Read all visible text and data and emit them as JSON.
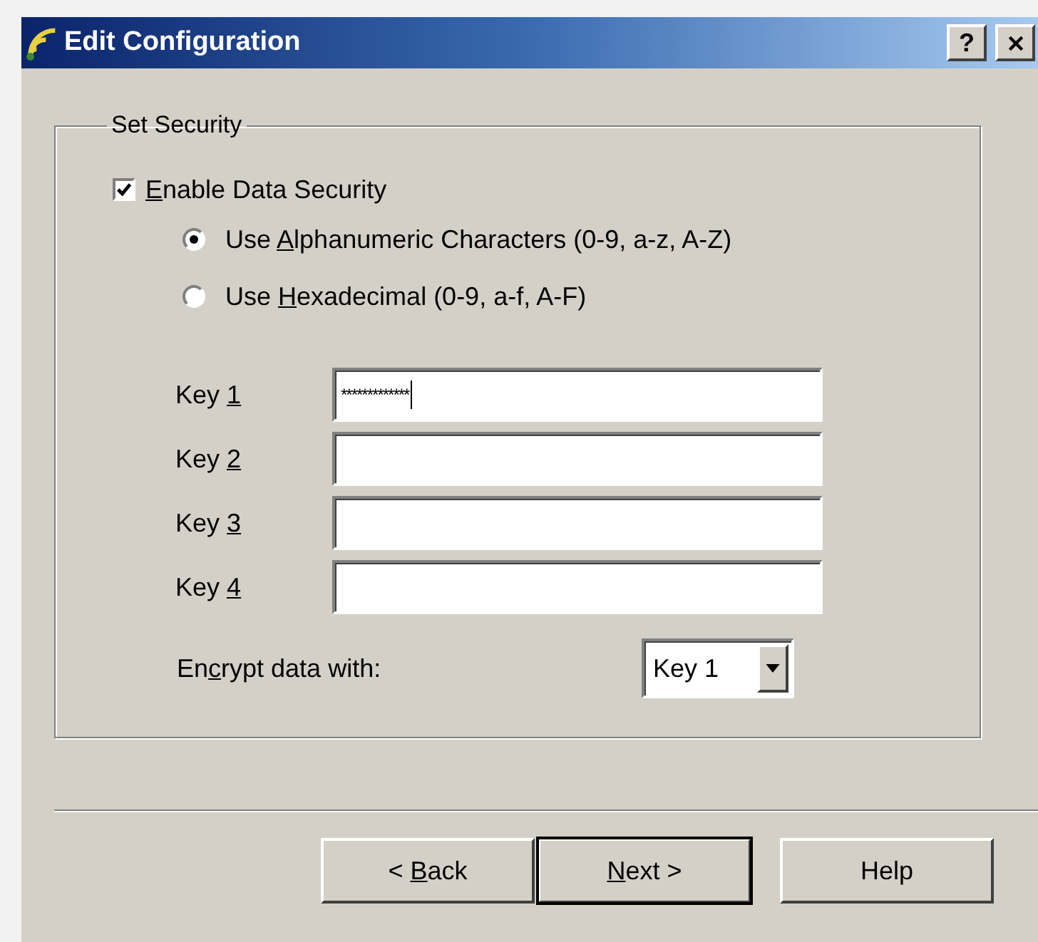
{
  "window": {
    "title": "Edit Configuration",
    "help_button": "?"
  },
  "group": {
    "title": "Set Security",
    "enable": {
      "label": {
        "key": "E",
        "after": "nable Data Security"
      },
      "checked": true
    },
    "radios": [
      {
        "label": {
          "before": "Use ",
          "key": "A",
          "after": "lphanumeric Characters (0-9, a-z, A-Z)"
        },
        "selected": true
      },
      {
        "label": {
          "before": "Use ",
          "key": "H",
          "after": "exadecimal (0-9, a-f, A-F)"
        },
        "selected": false
      }
    ],
    "keys": [
      {
        "label": {
          "before": "Key ",
          "key": "1"
        },
        "value": "*************",
        "focused": true
      },
      {
        "label": {
          "before": "Key ",
          "key": "2"
        },
        "focused": false
      },
      {
        "label": {
          "before": "Key ",
          "key": "3"
        },
        "focused": false
      },
      {
        "label": {
          "before": "Key ",
          "key": "4"
        },
        "focused": false
      }
    ],
    "encrypt": {
      "label": {
        "before": "En",
        "key": "c",
        "after": "rypt data with:"
      },
      "value": "Key 1"
    }
  },
  "buttons": [
    {
      "label": {
        "before": "< ",
        "key": "B",
        "after": "ack"
      },
      "default": false
    },
    {
      "label": {
        "key": "N",
        "after": "ext >"
      },
      "default": true
    },
    {
      "label": {
        "before": "Help"
      },
      "default": false
    }
  ]
}
